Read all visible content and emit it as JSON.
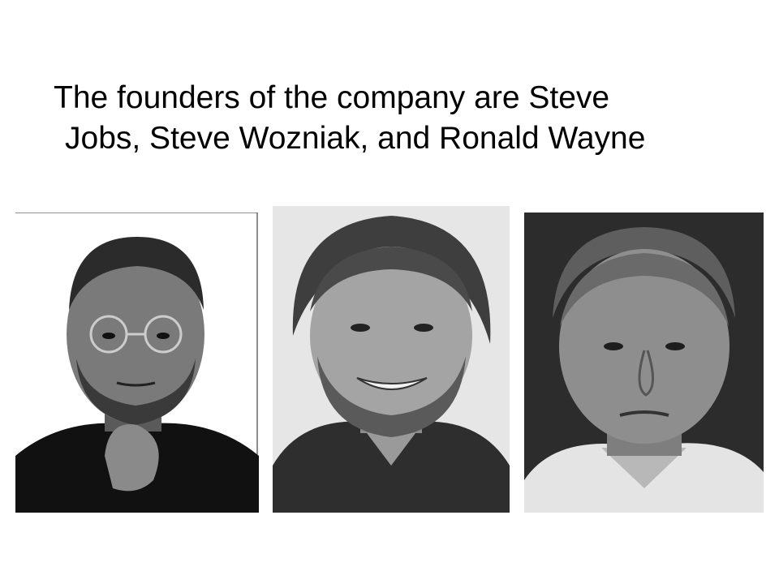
{
  "slide": {
    "title_line1": "The founders of the company are Steve",
    "title_line2": "Jobs, Steve Wozniak, and Ronald Wayne"
  },
  "photos": [
    {
      "subject": "Steve Jobs",
      "style": "black-and-white portrait"
    },
    {
      "subject": "Steve Wozniak",
      "style": "black-and-white portrait"
    },
    {
      "subject": "Ronald Wayne",
      "style": "black-and-white portrait"
    }
  ]
}
